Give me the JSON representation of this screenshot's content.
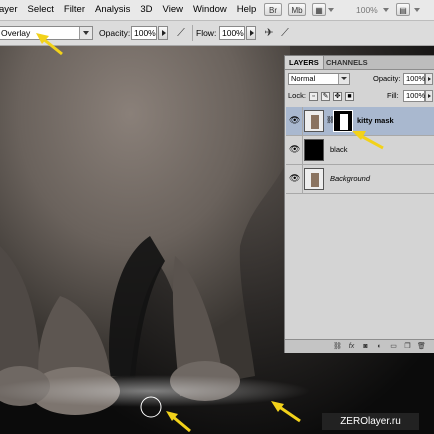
{
  "menubar": {
    "items": [
      "ayer",
      "Select",
      "Filter",
      "Analysis",
      "3D",
      "View",
      "Window",
      "Help"
    ],
    "br_label": "Br",
    "mb_label": "Mb",
    "zoom": "100%"
  },
  "options": {
    "mode": "Overlay",
    "opacity_label": "Opacity:",
    "opacity_value": "100%",
    "flow_label": "Flow:",
    "flow_value": "100%"
  },
  "layers_panel": {
    "tabs": [
      "LAYERS",
      "CHANNELS"
    ],
    "blend_mode": "Normal",
    "opacity_label": "Opacity:",
    "opacity_value": "100%",
    "lock_label": "Lock:",
    "fill_label": "Fill:",
    "fill_value": "100%",
    "layers": [
      {
        "name": "kitty mask",
        "selected": true
      },
      {
        "name": "black",
        "selected": false
      },
      {
        "name": "Background",
        "selected": false
      }
    ],
    "bottom_icons": [
      "link-icon",
      "fx-icon",
      "mask-icon",
      "adjustment-icon",
      "group-icon",
      "new-layer-icon",
      "trash-icon"
    ]
  },
  "watermark": "ZEROlayer.ru",
  "colors": {
    "arrow": "#f2d21a",
    "selected_row": "#a9b8cf"
  }
}
